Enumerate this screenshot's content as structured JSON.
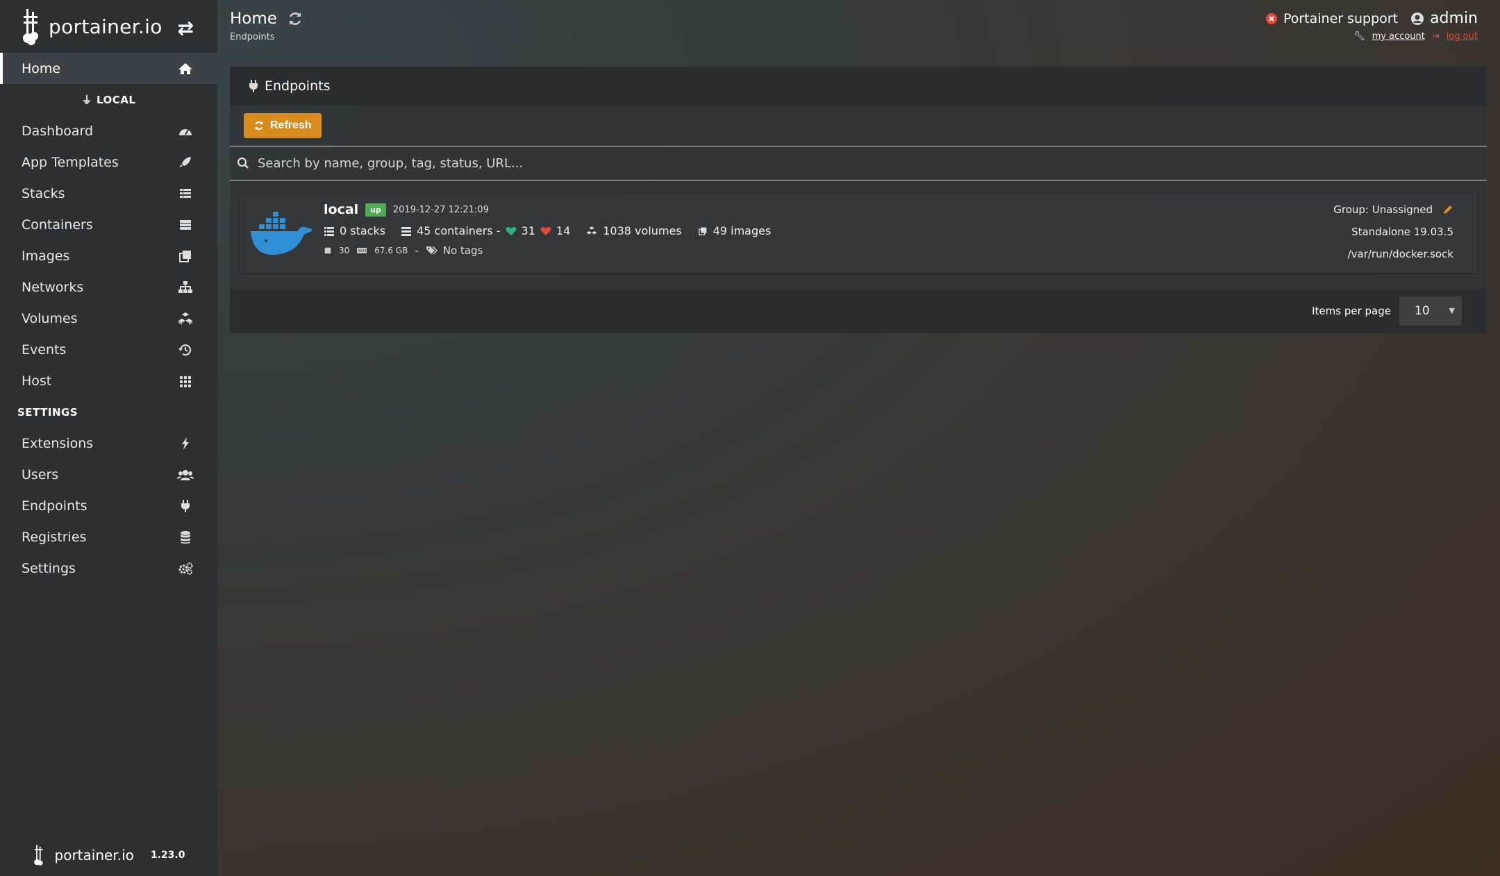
{
  "brand": {
    "logo_text": "portainer.io",
    "version": "1.23.0"
  },
  "sidebar": {
    "home": "Home",
    "local_label": "LOCAL",
    "items": [
      {
        "label": "Dashboard"
      },
      {
        "label": "App Templates"
      },
      {
        "label": "Stacks"
      },
      {
        "label": "Containers"
      },
      {
        "label": "Images"
      },
      {
        "label": "Networks"
      },
      {
        "label": "Volumes"
      },
      {
        "label": "Events"
      },
      {
        "label": "Host"
      }
    ],
    "settings_label": "SETTINGS",
    "settings_items": [
      {
        "label": "Extensions"
      },
      {
        "label": "Users"
      },
      {
        "label": "Endpoints"
      },
      {
        "label": "Registries"
      },
      {
        "label": "Settings"
      }
    ]
  },
  "header": {
    "title": "Home",
    "breadcrumb": "Endpoints"
  },
  "topright": {
    "support": "Portainer support",
    "user": "admin",
    "my_account": "my account",
    "log_out": "log out"
  },
  "panel": {
    "title": "Endpoints",
    "refresh": "Refresh",
    "search_placeholder": "Search by name, group, tag, status, URL...",
    "items_per_page_label": "Items per page",
    "items_per_page": "10"
  },
  "endpoint": {
    "name": "local",
    "status": "up",
    "timestamp": "2019-12-27 12:21:09",
    "stacks": "0 stacks",
    "containers": "45 containers -",
    "healthy": "31",
    "unhealthy": "14",
    "volumes": "1038 volumes",
    "images": "49 images",
    "cpu": "30",
    "memory": "67.6 GB",
    "sep": "-",
    "tags": "No tags",
    "group": "Group: Unassigned",
    "type": "Standalone 19.03.5",
    "url": "/var/run/docker.sock"
  },
  "colors": {
    "accent": "#d98b1c",
    "status_up": "#4caf50",
    "danger": "#e8473a",
    "docker_blue": "#2f8fd6"
  }
}
